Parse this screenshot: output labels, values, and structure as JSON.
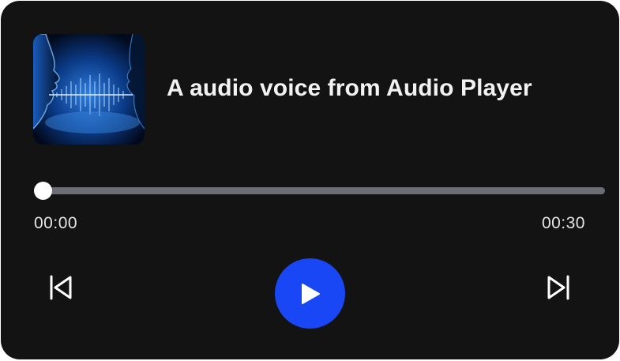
{
  "player": {
    "title": "A audio voice from Audio Player",
    "cover_icon": "voice-waveform-artwork",
    "current_time": "00:00",
    "total_time": "00:30",
    "progress": 0,
    "colors": {
      "background": "#131313",
      "accent": "#1a47f5",
      "track": "#6a6d73",
      "text": "#f2f2f2"
    },
    "controls": {
      "previous_icon": "skip-previous-icon",
      "play_icon": "play-icon",
      "next_icon": "skip-next-icon"
    }
  }
}
